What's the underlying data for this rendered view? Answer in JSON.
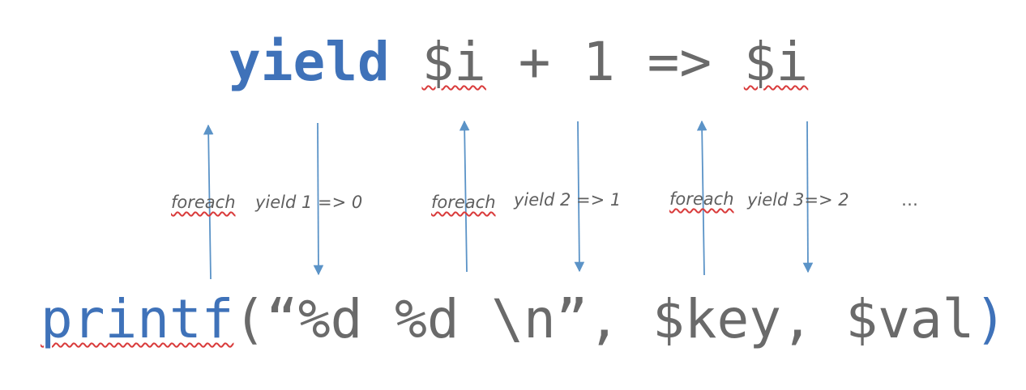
{
  "colors": {
    "keyword": "#3f72b9",
    "code": "#6a6a6a",
    "arrow": "#5b93c7",
    "label": "#5f5f5f",
    "squiggle": "#d93b3b"
  },
  "top_code": {
    "keyword": "yield",
    "space": " ",
    "var1": "$i",
    "middle": " + 1 => ",
    "var2": "$i"
  },
  "bottom_code": {
    "func": "printf",
    "args": "(“%d %d \\n”, $key, $val",
    "close": ")"
  },
  "labels": {
    "foreach_1": "foreach",
    "yield_1": "yield 1 => 0",
    "foreach_2": "foreach",
    "yield_2": "yield 2 => 1",
    "foreach_3": "foreach",
    "yield_3": "yield 3=> 2",
    "ellipsis": "…"
  }
}
